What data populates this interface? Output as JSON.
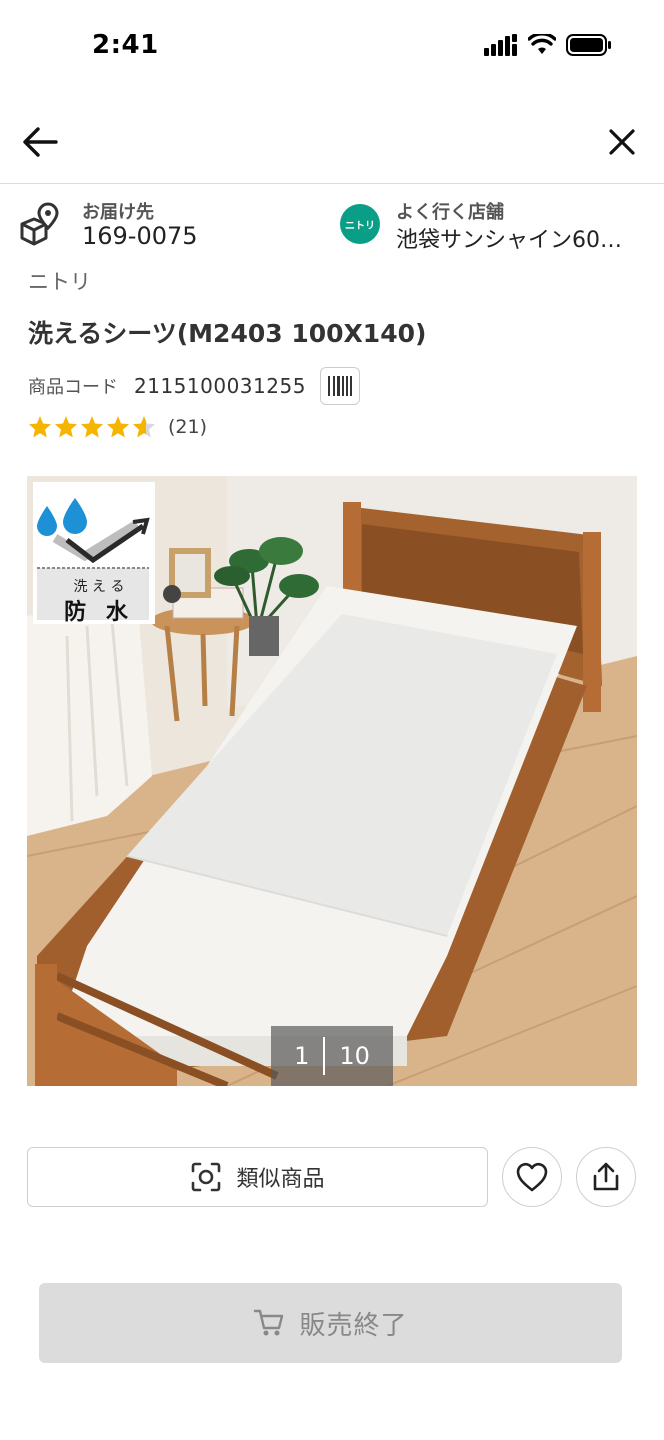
{
  "status_bar": {
    "time": "2:41"
  },
  "delivery": {
    "label": "お届け先",
    "value": "169-0075"
  },
  "store": {
    "logo_text": "ニトリ",
    "label": "よく行く店舗",
    "value": "池袋サンシャイン60…"
  },
  "product": {
    "brand": "ニトリ",
    "title": "洗えるシーツ(M2403 100X140)",
    "code_label": "商品コード",
    "code": "2115100031255",
    "rating": 4.5,
    "review_count": "(21)"
  },
  "gallery": {
    "badge_line1": "洗 え る",
    "badge_line2": "防 水",
    "current": "1",
    "total": "10"
  },
  "actions": {
    "similar_label": "類似商品",
    "soldout_label": "販売終了"
  }
}
